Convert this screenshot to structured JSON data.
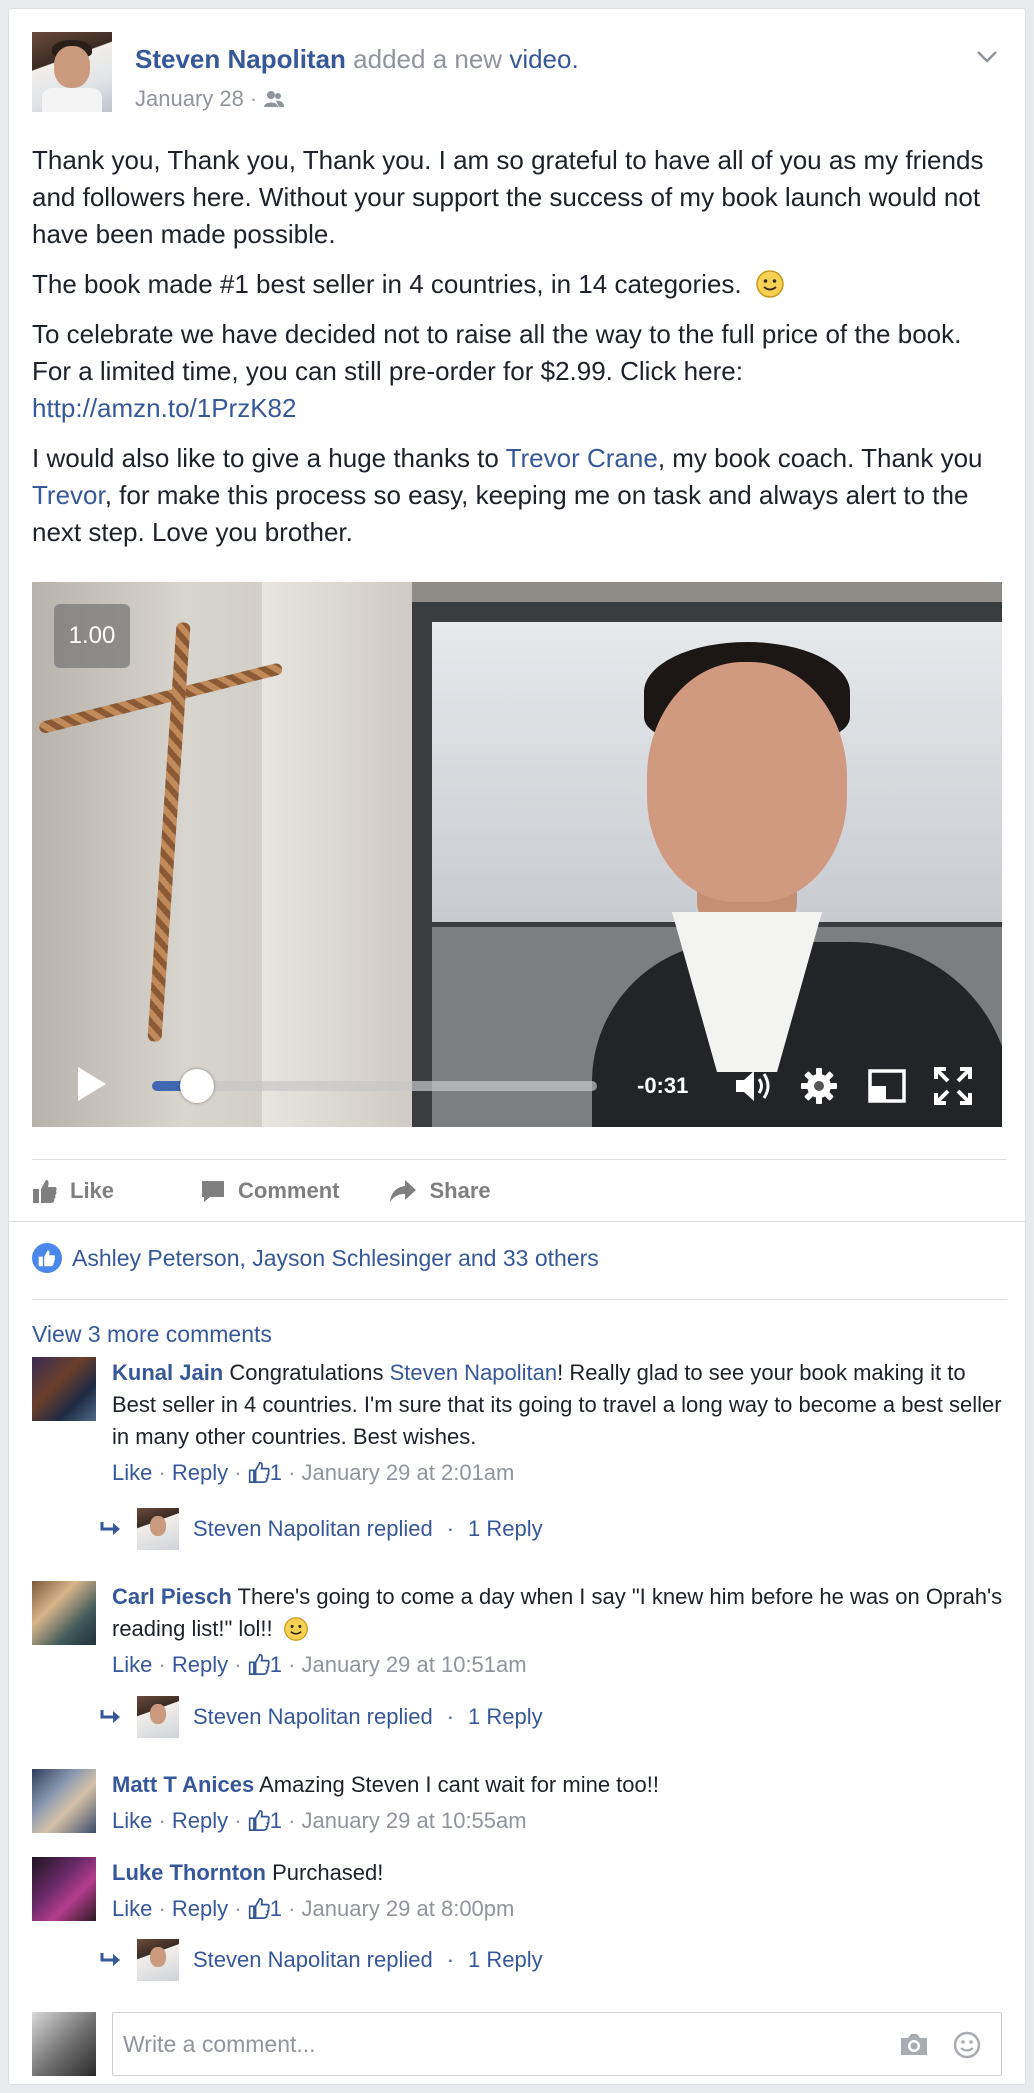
{
  "post": {
    "author": "Steven Napolitan",
    "action_text": "added a new",
    "action_link": "video.",
    "date": "January 28",
    "date_sep": "·",
    "paragraphs": {
      "p1": "Thank you, Thank you, Thank you. I am so grateful to have all of you as my friends and followers here. Without your support the success of my book launch would not have been made possible.",
      "p2": "The book made #1 best seller in 4 countries, in 14 categories.",
      "p3": "To celebrate we have decided not to raise all the way to the full price of the book. For a limited time, you can still pre-order for $2.99. Click here:",
      "p3_link": "http://amzn.to/1PrzK82",
      "p4_a": "I would also like to give a huge thanks to ",
      "p4_link1": "Trevor Crane",
      "p4_b": ", my book coach. Thank you ",
      "p4_link2": "Trevor",
      "p4_c": ", for make this process so easy, keeping me on task and always alert to the next step. Love you brother."
    }
  },
  "video": {
    "speed": "1.00",
    "progress": 0.1,
    "time_remaining": "-0:31",
    "icons": [
      "play-icon",
      "volume-icon",
      "gear-icon",
      "pip-icon",
      "fullscreen-icon"
    ]
  },
  "actions": {
    "like": "Like",
    "comment": "Comment",
    "share": "Share"
  },
  "likes": {
    "text": "Ashley Peterson, Jayson Schlesinger and 33 others"
  },
  "comments_link": "View 3 more comments",
  "comments": [
    {
      "name": "Kunal Jain",
      "text_a": " Congratulations ",
      "mention": "Steven Napolitan",
      "text_b": "! Really glad to see your book making it to Best seller in 4 countries. I'm sure that its going to travel a long way to become a best seller in many other countries. Best wishes.",
      "like": "Like",
      "reply": "Reply",
      "likes": "1",
      "time": "January 29 at 2:01am",
      "replied": "Steven Napolitan replied",
      "reply_count": "1 Reply"
    },
    {
      "name": "Carl Piesch",
      "text": " There's going to come a day when I say \"I knew him before he was on Oprah's reading list!\" lol!!",
      "like": "Like",
      "reply": "Reply",
      "likes": "1",
      "time": "January 29 at 10:51am",
      "replied": "Steven Napolitan replied",
      "reply_count": "1 Reply"
    },
    {
      "name": "Matt T Anices",
      "text": " Amazing Steven I cant wait for mine too!!",
      "like": "Like",
      "reply": "Reply",
      "likes": "1",
      "time": "January 29 at 10:55am"
    },
    {
      "name": "Luke Thornton",
      "text": " Purchased!",
      "like": "Like",
      "reply": "Reply",
      "likes": "1",
      "time": "January 29 at 8:00pm",
      "replied": "Steven Napolitan replied",
      "reply_count": "1 Reply"
    }
  ],
  "composer": {
    "placeholder": "Write a comment..."
  },
  "colors": {
    "link": "#365899",
    "muted": "#90949c",
    "accent": "#4267b2",
    "like_badge": "#4a88ec"
  }
}
